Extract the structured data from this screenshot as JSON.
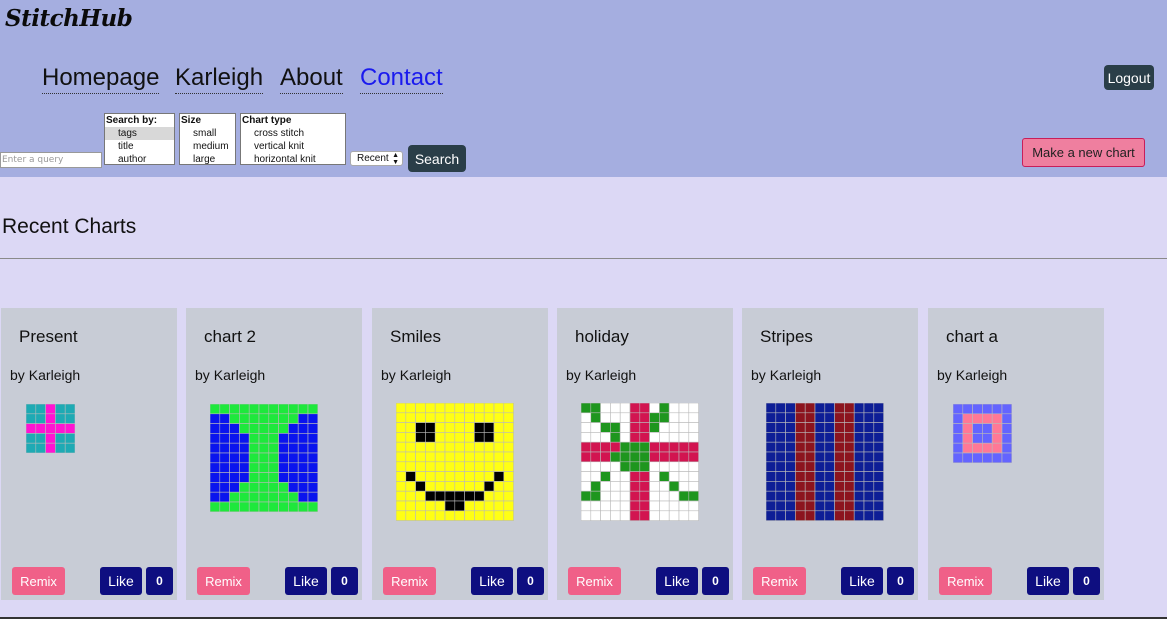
{
  "header": {
    "logo": "StitchHub",
    "nav": [
      "Homepage",
      "Karleigh",
      "About",
      "Contact"
    ],
    "logout_label": "Logout",
    "make_chart_label": "Make a new chart"
  },
  "search": {
    "placeholder": "Enter a query",
    "search_by": {
      "label": "Search by:",
      "options": [
        "tags",
        "title",
        "author"
      ],
      "selected": "tags"
    },
    "size": {
      "label": "Size",
      "options": [
        "small",
        "medium",
        "large"
      ]
    },
    "chart_type": {
      "label": "Chart type",
      "options": [
        "cross stitch",
        "vertical knit",
        "horizontal knit"
      ]
    },
    "sort_value": "Recent",
    "button_label": "Search"
  },
  "section_title": "Recent Charts",
  "card_labels": {
    "by": "by",
    "remix": "Remix",
    "like": "Like"
  },
  "colors": {
    "header_bg": "#a5aee0",
    "page_bg": "#dcd8f5",
    "card_bg": "#c8ccd6",
    "remix": "#f06088",
    "like": "#0e0e80",
    "make_chart": "#ef7f9f"
  },
  "cards": [
    {
      "title": "Present",
      "author": "Karleigh",
      "likes": "0",
      "palette": {
        "a": "#1eaab4",
        "b": "#ff14d2"
      },
      "rows": [
        "aabaa",
        "aabaa",
        "bbbbb",
        "aabaa",
        "aabaa"
      ]
    },
    {
      "title": "chart 2",
      "author": "Karleigh",
      "likes": "0",
      "palette": {
        "g": "#1ee83c",
        "b": "#0a14ee"
      },
      "rows": [
        "ggggggggggg",
        "bbgggggggbb",
        "bbbgggggbbb",
        "bbbbgggbbbb",
        "bbbbgggbbbb",
        "bbbbgggbbbb",
        "bbbbgggbbbb",
        "bbbbgggbbbb",
        "bbbgggggbbb",
        "bbgggggggbb",
        "ggggggggggg"
      ]
    },
    {
      "title": "Smiles",
      "author": "Karleigh",
      "likes": "0",
      "palette": {
        "y": "#ffff14",
        "k": "#000000"
      },
      "rows": [
        "yyyyyyyyyyyy",
        "yyyyyyyyyyyy",
        "yykkyyyykkyy",
        "yykkyyyykkyy",
        "yyyyyyyyyyyy",
        "yyyyyyyyyyyy",
        "yyyyyyyyyyyy",
        "ykyyyyyyyyky",
        "yykyyyyyykyy",
        "yyykkkkkkyyy",
        "yyyyykkyyyyy",
        "yyyyyyyyyyyy"
      ]
    },
    {
      "title": "holiday",
      "author": "Karleigh",
      "likes": "0",
      "palette": {
        "w": "#ffffff",
        "g": "#1e961e",
        "r": "#d21450"
      },
      "rows": [
        "ggwwwrrwgwww",
        "wgwwwrrggwww",
        "wwggwrrgwwww",
        "wwwgwrrwwwww",
        "rrrrgggrrrrr",
        "rrrggggrrrrr",
        "wwwwgggwwwww",
        "wwgwwrrwgwww",
        "wgwwwrrwwgww",
        "ggwwwrrwwwgg",
        "wwwwwrrwwwww",
        "wwwwwrrwwwww"
      ]
    },
    {
      "title": "Stripes",
      "author": "Karleigh",
      "likes": "0",
      "palette": {
        "b": "#0e1e96",
        "r": "#8c141e"
      },
      "rows": [
        "bbbrrbbrrbbb",
        "bbbrrbbrrbbb",
        "bbbrrbbrrbbb",
        "bbbrrbbrrbbb",
        "bbbrrbbrrbbb",
        "bbbrrbbrrbbb",
        "bbbrrbbrrbbb",
        "bbbrrbbrrbbb",
        "bbbrrbbrrbbb",
        "bbbrrbbrrbbb",
        "bbbrrbbrrbbb",
        "bbbrrbbrrbbb"
      ]
    },
    {
      "title": "chart a",
      "author": "Karleigh",
      "likes": "0",
      "palette": {
        "p": "#6464ff",
        "k": "#ff7896"
      },
      "rows": [
        "pppppp",
        "pkkkkp",
        "pkppkp",
        "pkppkp",
        "pkkkkp",
        "pppppp"
      ]
    }
  ]
}
